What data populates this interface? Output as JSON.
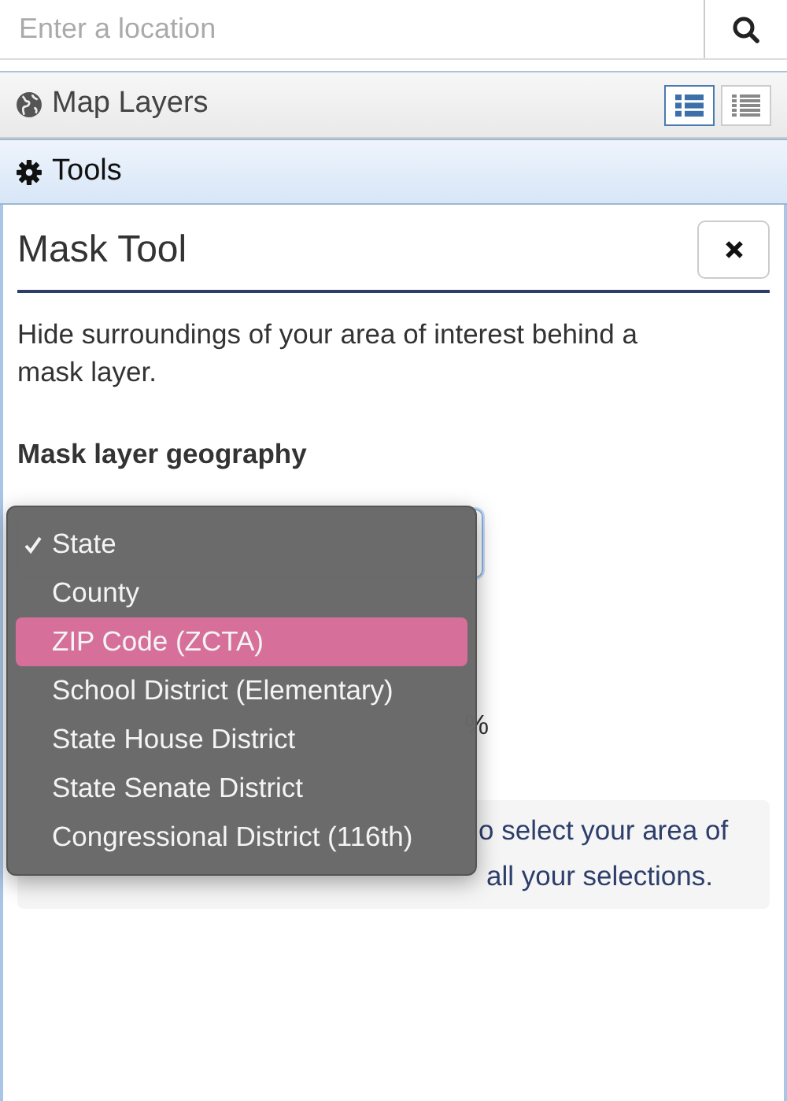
{
  "search": {
    "placeholder": "Enter a location"
  },
  "layers_panel": {
    "title": "Map Layers",
    "view_toggles": [
      {
        "kind": "detailed",
        "selected": true
      },
      {
        "kind": "compact",
        "selected": false
      }
    ]
  },
  "tools_panel": {
    "title": "Tools"
  },
  "mask_tool": {
    "title": "Mask Tool",
    "description": "Hide surroundings of your area of interest behind a mask layer.",
    "geography_label": "Mask layer geography",
    "geography_options": [
      {
        "label": "State",
        "checked": true,
        "selected": false
      },
      {
        "label": "County",
        "checked": false,
        "selected": false
      },
      {
        "label": "ZIP Code (ZCTA)",
        "checked": false,
        "selected": true
      },
      {
        "label": "School District (Elementary)",
        "checked": false,
        "selected": false
      },
      {
        "label": "State House District",
        "checked": false,
        "selected": false
      },
      {
        "label": "State Senate District",
        "checked": false,
        "selected": false
      },
      {
        "label": "Congressional District (116th)",
        "checked": false,
        "selected": false
      }
    ],
    "opacity_suffix": "%",
    "info_lines": [
      "o select your area of",
      "all your selections."
    ]
  }
}
